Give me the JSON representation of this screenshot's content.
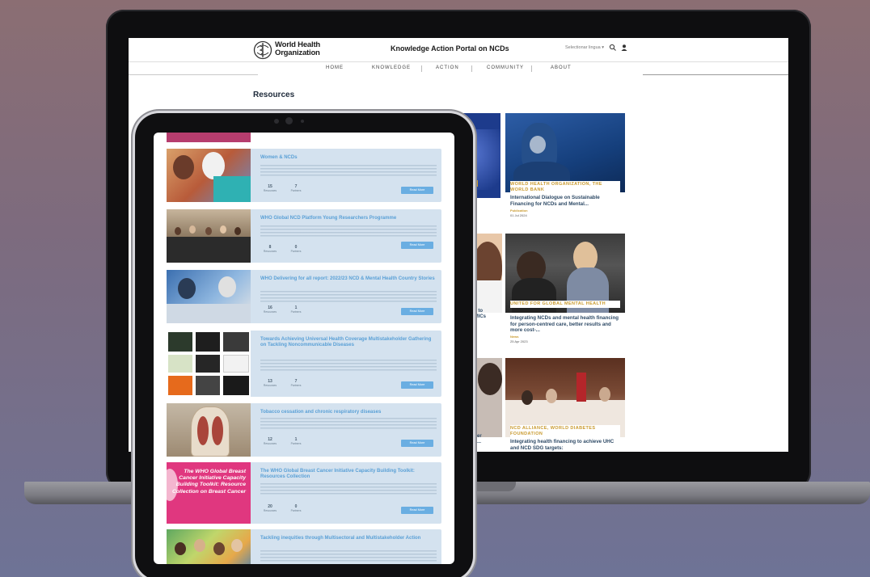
{
  "laptop_site": {
    "org_name_line1": "World Health",
    "org_name_line2": "Organization",
    "portal_title": "Knowledge Action Portal on NCDs",
    "language_select": "Selectionar lingua ▾",
    "nav": [
      "HOME",
      "KNOWLEDGE",
      "ACTION",
      "COMMUNITY",
      "ABOUT"
    ],
    "section_title": "Resources",
    "cards": [
      {
        "tag": "WORLD HEALTH ORGANIZATION, THE WORLD BANK",
        "title": "International Dialogue on Sustainable Financing for NCDs and Mental...",
        "type": "Publication",
        "date": "01 Jul 2024"
      },
      {
        "tag": "UNITED FOR GLOBAL MENTAL HEALTH",
        "title": "Integrating NCDs and mental health financing for person-centred care, better results and more cost-...",
        "type": "News",
        "date": "25 Apr 2023"
      },
      {
        "tag": "NCD ALLIANCE, WORLD DIABETES FOUNDATION",
        "title": "Integrating health financing to achieve UHC and NCD SDG targets:"
      }
    ],
    "partial_texts": [
      "ay to",
      "LMICs",
      "ncer",
      "ne..."
    ]
  },
  "tablet_site": {
    "cards": [
      {
        "title": "Women & NCDs",
        "stats": [
          {
            "num": "15",
            "label": "Resources"
          },
          {
            "num": "7",
            "label": "Partners"
          }
        ],
        "button": "Read More"
      },
      {
        "title": "WHO Global NCD Platform Young Researchers Programme",
        "stats": [
          {
            "num": "8",
            "label": "Resources"
          },
          {
            "num": "0",
            "label": "Partners"
          }
        ],
        "button": "Read More"
      },
      {
        "title": "WHO Delivering for all report: 2022/23 NCD & Mental Health Country Stories",
        "stats": [
          {
            "num": "16",
            "label": "Resources"
          },
          {
            "num": "1",
            "label": "Partners"
          }
        ],
        "button": "Read More"
      },
      {
        "title": "Towards Achieving Universal Health Coverage Multistakeholder Gathering on Tackling Noncommunicable Diseases",
        "stats": [
          {
            "num": "13",
            "label": "Resources"
          },
          {
            "num": "7",
            "label": "Partners"
          }
        ],
        "button": "Read More"
      },
      {
        "title": "Tobacco cessation and chronic respiratory diseases",
        "stats": [
          {
            "num": "12",
            "label": "Resources"
          },
          {
            "num": "1",
            "label": "Partners"
          }
        ],
        "button": "Read More"
      },
      {
        "title": "The WHO Global Breast Cancer Initiative Capacity Building Toolkit: Resources Collection",
        "image_text": "The WHO Global Breast Cancer Initiative Capacity Building Toolkit: Resource Collection on Breast Cancer",
        "stats": [
          {
            "num": "20",
            "label": "Resources"
          },
          {
            "num": "0",
            "label": "Partners"
          }
        ],
        "button": "Read More"
      },
      {
        "title": "Tackling inequities through Multisectoral and Multistakeholder Action"
      }
    ]
  },
  "colors": {
    "background_top": "#8b6e73",
    "background_bottom": "#6e7396",
    "card_tag_gold": "#c99a2e",
    "card_title_navy": "#2e4a66",
    "tablet_card_bg": "#d4e2ef",
    "tablet_title_blue": "#5aa0d6",
    "tablet_button_blue": "#6aaee2",
    "pink_banner": "#e0377f"
  },
  "icons": [
    "who-emblem-icon",
    "search-icon",
    "user-icon"
  ]
}
